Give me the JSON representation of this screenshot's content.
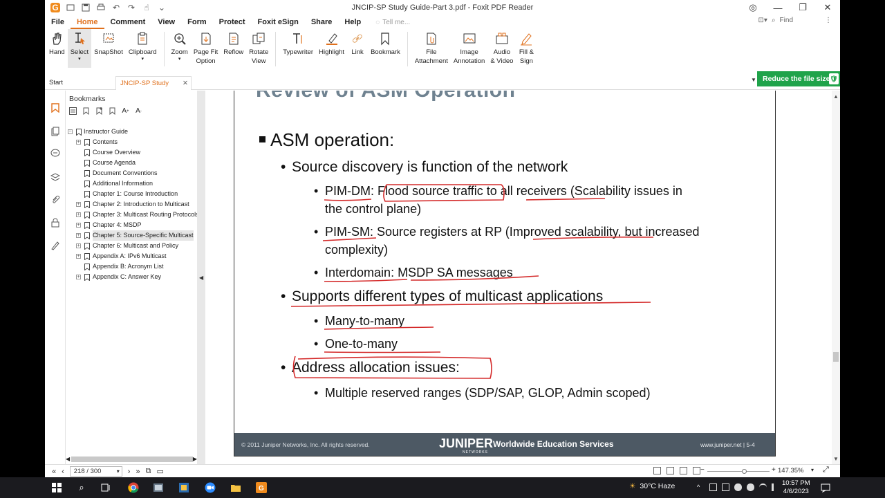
{
  "window": {
    "title": "JNCIP-SP Study Guide-Part 3.pdf - Foxit PDF Reader"
  },
  "menu": {
    "items": [
      "File",
      "Home",
      "Comment",
      "View",
      "Form",
      "Protect",
      "Foxit eSign",
      "Share",
      "Help"
    ],
    "active": "Home",
    "tell_me": "Tell me...",
    "find_placeholder": "Find"
  },
  "ribbon": {
    "tools": [
      {
        "label": "Hand",
        "icon": "hand-icon"
      },
      {
        "label": "Select",
        "icon": "select-cursor-icon",
        "dropdown": true
      },
      {
        "label": "SnapShot",
        "icon": "snapshot-icon"
      },
      {
        "label": "Clipboard",
        "icon": "clipboard-icon",
        "dropdown": true
      },
      {
        "label": "Zoom",
        "icon": "zoom-icon",
        "dropdown": true
      },
      {
        "label": "Page Fit\nOption",
        "icon": "page-fit-icon",
        "dropdown": true
      },
      {
        "label": "Reflow",
        "icon": "reflow-icon"
      },
      {
        "label": "Rotate\nView",
        "icon": "rotate-icon",
        "dropdown": true
      },
      {
        "label": "Typewriter",
        "icon": "typewriter-icon"
      },
      {
        "label": "Highlight",
        "icon": "highlight-icon"
      },
      {
        "label": "Link",
        "icon": "link-icon"
      },
      {
        "label": "Bookmark",
        "icon": "bookmark-icon"
      },
      {
        "label": "File\nAttachment",
        "icon": "file-attachment-icon"
      },
      {
        "label": "Image\nAnnotation",
        "icon": "image-annotation-icon"
      },
      {
        "label": "Audio\n& Video",
        "icon": "audio-video-icon"
      },
      {
        "label": "Fill &\nSign",
        "icon": "fill-sign-icon"
      }
    ]
  },
  "tabs": {
    "start": "Start",
    "doc": "JNCIP-SP Study Guide...",
    "reduce": "Reduce the file size"
  },
  "bookmarks": {
    "title": "Bookmarks",
    "items": [
      {
        "label": "Instructor Guide",
        "level": 0,
        "expander": "-"
      },
      {
        "label": "Contents",
        "level": 1,
        "expander": "+"
      },
      {
        "label": "Course Overview",
        "level": 1,
        "expander": ""
      },
      {
        "label": "Course Agenda",
        "level": 1,
        "expander": ""
      },
      {
        "label": "Document Conventions",
        "level": 1,
        "expander": ""
      },
      {
        "label": "Additional Information",
        "level": 1,
        "expander": ""
      },
      {
        "label": "Chapter 1: Course Introduction",
        "level": 1,
        "expander": ""
      },
      {
        "label": "Chapter 2: Introduction to Multicast",
        "level": 1,
        "expander": "+"
      },
      {
        "label": "Chapter 3: Multicast Routing Protocols",
        "level": 1,
        "expander": "+"
      },
      {
        "label": "Chapter 4: MSDP",
        "level": 1,
        "expander": "+"
      },
      {
        "label": "Chapter 5: Source-Specific Multicast",
        "level": 1,
        "expander": "+",
        "selected": true
      },
      {
        "label": "Chapter 6: Multicast and Policy",
        "level": 1,
        "expander": "+"
      },
      {
        "label": "Appendix A: IPv6 Multicast",
        "level": 1,
        "expander": "+"
      },
      {
        "label": "Appendix B: Acronym List",
        "level": 1,
        "expander": ""
      },
      {
        "label": "Appendix C: Answer Key",
        "level": 1,
        "expander": "+"
      }
    ]
  },
  "slide": {
    "title": "Review of ASM Operation",
    "l1_text": "ASM operation:",
    "b1_text": "Source discovery is function of the network",
    "pimdm": "PIM-DM",
    "pimdm_rest1": ": ",
    "pimdm_flood": "Flood source traffic",
    "pimdm_to": " to ",
    "pimdm_all": "all receivers",
    "pimdm_tail": " (Scalability issues in",
    "pimdm_line2": "the control plane)",
    "pimsm": "PIM-SM",
    "pimsm_tail": ": Source registers at RP (Improved scalability, but increased",
    "pimsm_line2": "complexity)",
    "inter": "Interdomain",
    "inter_tail": ": MSDP SA messages",
    "b2_text": "Supports different types of multicast applications",
    "m2m": "Many-to-many",
    "o2m": "One-to-many",
    "b3_text": "Address allocation issues:",
    "reserved": "Multiple reserved ranges (SDP/SAP, GLOP, Admin scoped)",
    "footer_copy": "© 2011 Juniper Networks, Inc. All rights reserved.",
    "footer_logo": "JUNIPER",
    "footer_logo_sub": "NETWORKS",
    "footer_wes": "Worldwide Education Services",
    "footer_url": "www.juniper.net  |  5-4"
  },
  "status": {
    "page": "218 / 300",
    "zoom": "147.35%"
  },
  "taskbar": {
    "weather": "30°C  Haze",
    "time": "10:57 PM",
    "date": "4/6/2023"
  }
}
